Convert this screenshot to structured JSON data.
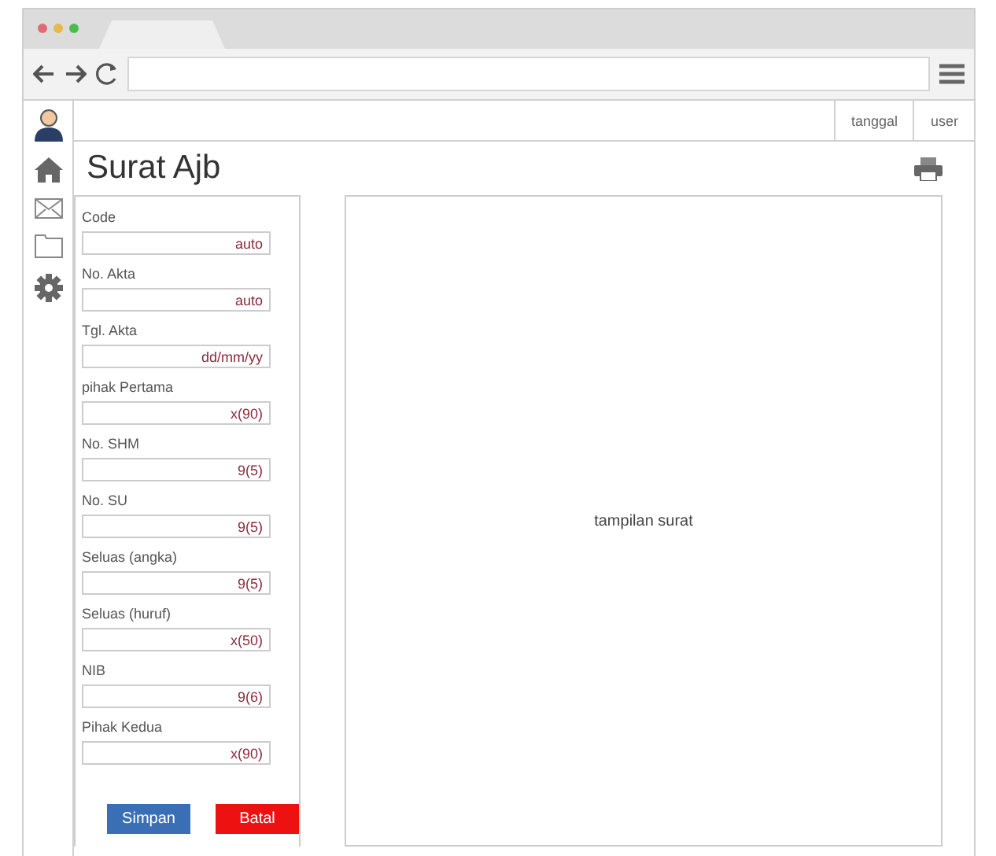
{
  "header": {
    "date_label": "tanggal",
    "user_label": "user"
  },
  "page": {
    "title": "Surat Ajb"
  },
  "form": {
    "fields": [
      {
        "label": "Code",
        "value": "auto"
      },
      {
        "label": "No. Akta",
        "value": "auto"
      },
      {
        "label": "Tgl. Akta",
        "value": "dd/mm/yy"
      },
      {
        "label": "pihak Pertama",
        "value": "x(90)"
      },
      {
        "label": "No. SHM",
        "value": "9(5)"
      },
      {
        "label": "No. SU",
        "value": "9(5)"
      },
      {
        "label": "Seluas (angka)",
        "value": "9(5)"
      },
      {
        "label": "Seluas (huruf)",
        "value": "x(50)"
      },
      {
        "label": "NIB",
        "value": "9(6)"
      },
      {
        "label": "Pihak Kedua",
        "value": "x(90)"
      }
    ],
    "buttons": [
      {
        "label": "Simpan",
        "kind": "primary"
      },
      {
        "label": "Batal",
        "kind": "danger"
      }
    ]
  },
  "preview": {
    "label": "tampilan surat"
  }
}
